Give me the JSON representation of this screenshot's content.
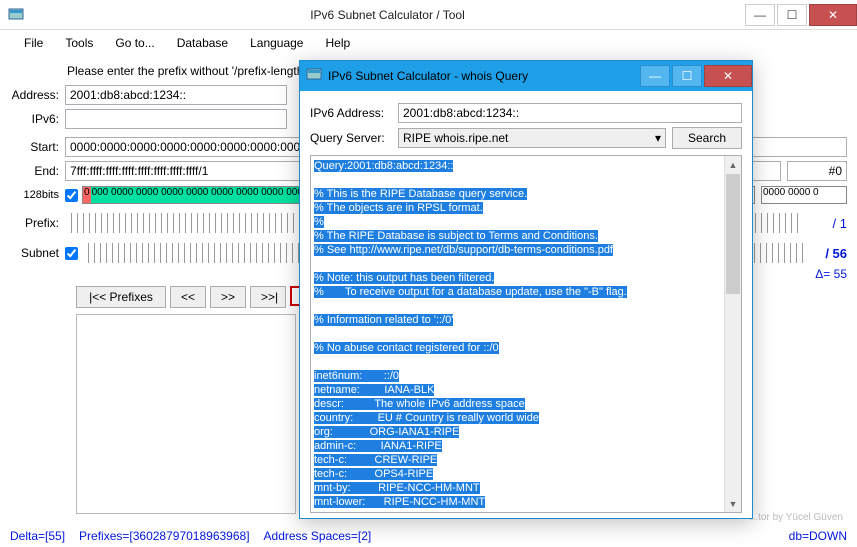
{
  "main_window": {
    "title": "IPv6 Subnet Calculator / Tool",
    "menu": {
      "file": "File",
      "tools": "Tools",
      "goto": "Go to...",
      "database": "Database",
      "language": "Language",
      "help": "Help"
    },
    "hint": "Please enter the prefix without '/prefix-length'",
    "labels": {
      "address": "Address:",
      "ipv6": "IPv6:",
      "start": "Start:",
      "end": "End:",
      "bits": "128bits",
      "prefix": "Prefix:",
      "subnet": "Subnet"
    },
    "values": {
      "address": "2001:db8:abcd:1234::",
      "ipv6": "",
      "start": "0000:0000:0000:0000:0000:0000:0000:0000/",
      "end": "7fff:ffff:ffff:ffff:ffff:ffff:ffff:ffff/1",
      "end_idx": "#0",
      "bits_red": "0",
      "bits_green": "000 0000 0000 0000 0000 0000 0000 0000 000",
      "bits_right": "0000 0000 0",
      "prefix_val": "/ 1",
      "subnet_val": "/ 56",
      "delta_val": "Δ= 55"
    },
    "nav": {
      "back_all": "|<< Prefixes",
      "back": "<<",
      "fwd": ">>",
      "fwd_all": ">>|"
    },
    "status": {
      "delta": "Delta=[55]",
      "prefixes": "Prefixes=[36028797018963968]",
      "spaces": "Address Spaces=[2]",
      "db": "db=DOWN"
    },
    "footer": "...tor by Yücel Güven"
  },
  "popup": {
    "title": "IPv6 Subnet Calculator - whois Query",
    "labels": {
      "addr": "IPv6 Address:",
      "server": "Query Server:",
      "search": "Search"
    },
    "values": {
      "addr": "2001:db8:abcd:1234::",
      "server": "RIPE whois.ripe.net"
    },
    "result_lines": [
      "Query:2001:db8:abcd:1234::",
      "",
      "% This is the RIPE Database query service.",
      "% The objects are in RPSL format.",
      "%",
      "% The RIPE Database is subject to Terms and Conditions.",
      "% See http://www.ripe.net/db/support/db-terms-conditions.pdf",
      "",
      "% Note: this output has been filtered.",
      "%       To receive output for a database update, use the \"-B\" flag.",
      "",
      "% Information related to '::/0'",
      "",
      "% No abuse contact registered for ::/0",
      "",
      "inet6num:       ::/0",
      "netname:        IANA-BLK",
      "descr:          The whole IPv6 address space",
      "country:        EU # Country is really world wide",
      "org:            ORG-IANA1-RIPE",
      "admin-c:        IANA1-RIPE",
      "tech-c:         CREW-RIPE",
      "tech-c:         OPS4-RIPE",
      "mnt-by:         RIPE-NCC-HM-MNT",
      "mnt-lower:      RIPE-NCC-HM-MNT"
    ]
  }
}
